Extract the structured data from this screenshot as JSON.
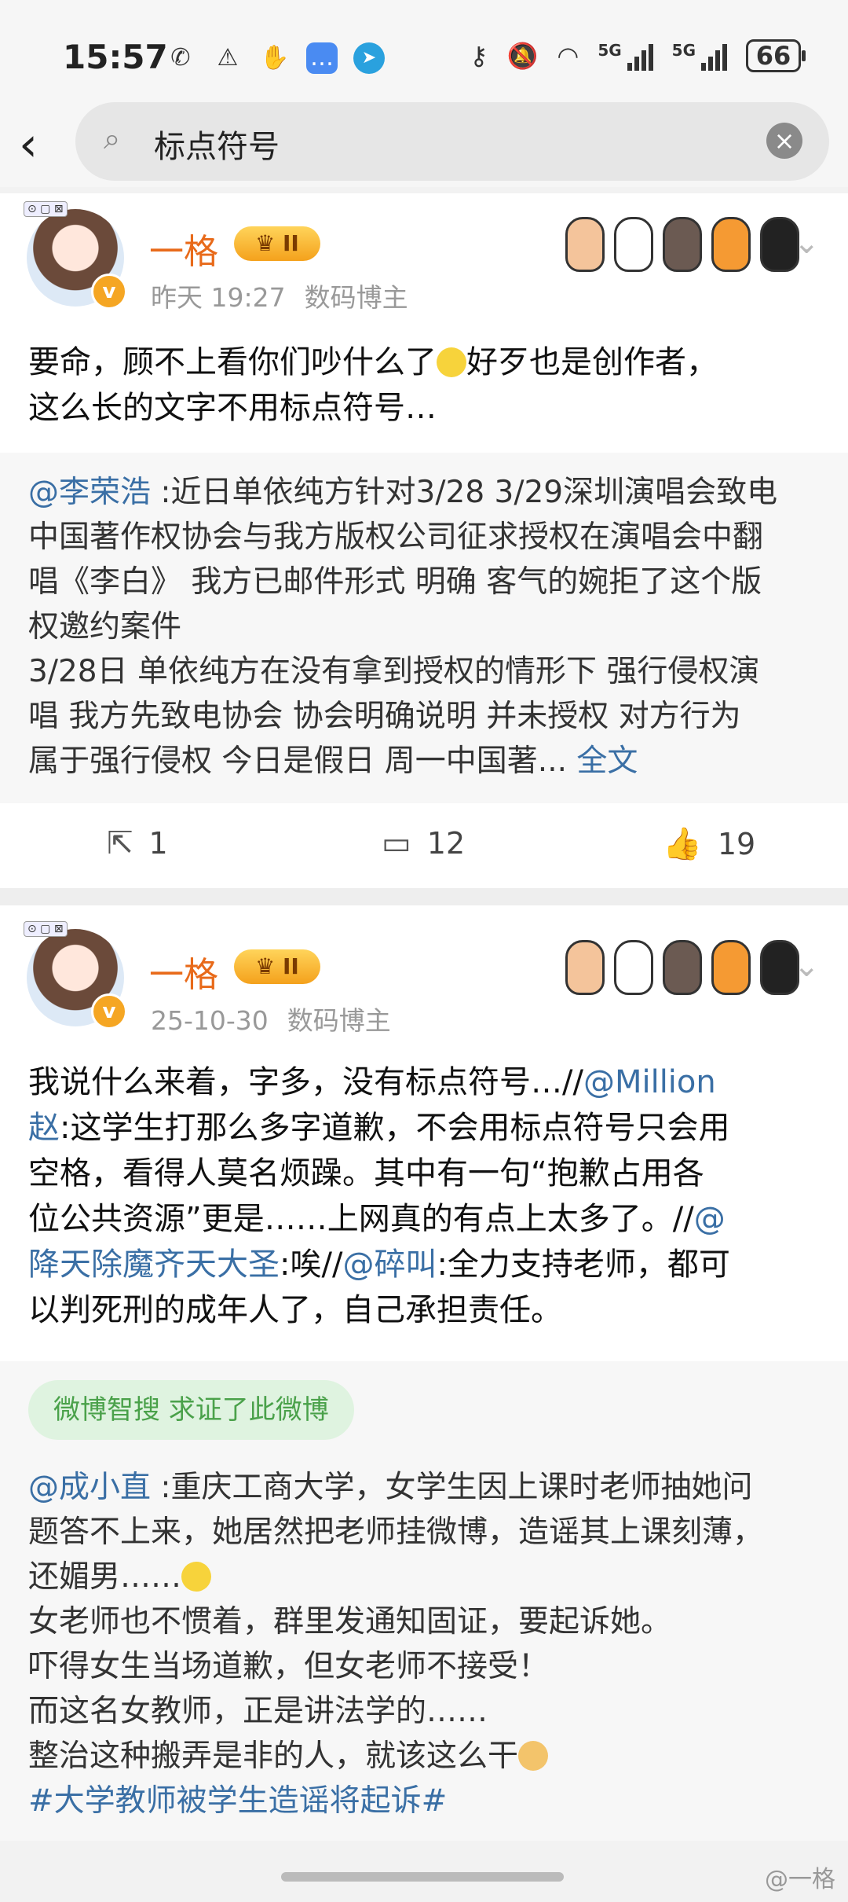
{
  "status": {
    "time": "15:57",
    "battery": "66",
    "net1": "5G",
    "net2": "5G"
  },
  "search": {
    "query": "标点符号"
  },
  "posts": [
    {
      "author": "一格",
      "badge": "II",
      "time": "昨天 19:27",
      "tag": "数码博主",
      "text_l1": "要命，顾不上看你们吵什么了",
      "text_l1b": "好歹也是创作者，",
      "text_l2": "这么长的文字不用标点符号…",
      "repost_user": "@李荣浩",
      "repost_lines": [
        " :近日单依纯方针对3/28 3/29深圳演唱会致电",
        "中国著作权协会与我方版权公司征求授权在演唱会中翻",
        "唱《李白》 我方已邮件形式 明确 客气的婉拒了这个版",
        "权邀约案件",
        "3/28日 单依纯方在没有拿到授权的情形下 强行侵权演",
        "唱 我方先致电协会 协会明确说明 并未授权 对方行为",
        "属于强行侵权 今日是假日 周一中国著... "
      ],
      "full_text_link": "全文",
      "reposts": "1",
      "comments": "12",
      "likes": "19"
    },
    {
      "author": "一格",
      "badge": "II",
      "time": "25-10-30",
      "tag": "数码博主",
      "lines": [
        [
          "我说什么来着，字多，没有标点符号…//",
          "@Million"
        ],
        [
          "赵",
          ":这学生打那么多字道歉，不会用标点符号只会用"
        ],
        [
          "空格，看得人莫名烦躁。其中有一句“抱歉占用各",
          ""
        ],
        [
          "位公共资源”更是……上网真的有点上太多了。//",
          "@"
        ],
        [
          "降天除魔齐天大圣",
          ":唉//"
        ],
        [
          "@碎叫",
          ":全力支持老师，都可"
        ],
        [
          "以判死刑的成年人了，自己承担责任。",
          ""
        ]
      ],
      "verify_pill": "微博智搜 求证了此微博",
      "repost_user": "@成小直",
      "repost_lines": [
        " :重庆工商大学，女学生因上课时老师抽她问",
        "题答不上来，她居然把老师挂微博，造谣其上课刻薄，",
        "还媚男……",
        "女老师也不惯着，群里发通知固证，要起诉她。",
        "吓得女生当场道歉，但女老师不接受！",
        "而这名女教师，正是讲法学的……",
        "整治这种搬弄是非的人，就该这么干"
      ],
      "hashtag": "#大学教师被学生造谣将起诉#"
    }
  ],
  "watermark": "@一格",
  "colors": {
    "accent": "#e86a1a",
    "link": "#3a6fa5",
    "pill_bg": "#dff3e0",
    "pill_text": "#4aa14a"
  }
}
